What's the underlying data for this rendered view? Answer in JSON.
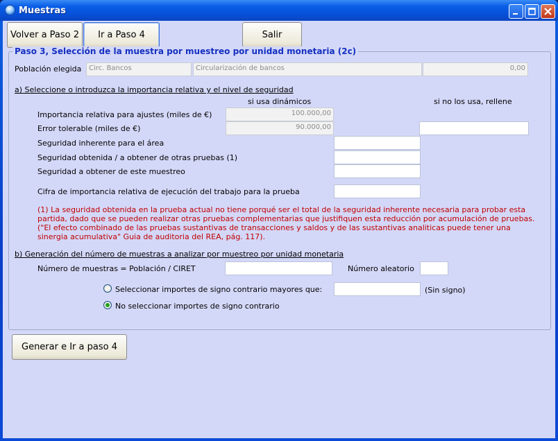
{
  "window": {
    "title": "Muestras"
  },
  "toolbar": {
    "back_label": "Volver a Paso 2",
    "goto_label": "Ir a Paso 4",
    "exit_label": "Salir"
  },
  "group": {
    "title": "Paso 3, Selección de la muestra por muestreo por unidad monetaria (2c)"
  },
  "population": {
    "label": "Población elegida",
    "code": "Circ. Bancos",
    "description": "Circularización de bancos",
    "amount": "0,00"
  },
  "section_a": {
    "title": "a) Seleccione o introduzca la importancia relativa y el nivel de seguridad",
    "col_dynamic": "si usa dinámicos",
    "col_manual": "si no los usa, rellene",
    "materiality_label": "Importancia relativa para ajustes (miles de €)",
    "materiality_value": "100.000,00",
    "tolerable_label": "Error tolerable (miles de €)",
    "tolerable_value": "90.000,00",
    "tolerable_manual": "",
    "inherent_label": "Seguridad inherente para el área",
    "inherent_value": "",
    "obtained_label": "Seguridad obtenida / a obtener de otras pruebas (1)",
    "obtained_value": "",
    "sampling_label": "Seguridad a obtener de este muestreo",
    "sampling_value": "",
    "execution_label": "Cifra de importancia relativa de ejecución del trabajo para la prueba",
    "execution_value": ""
  },
  "note": "(1) La seguridad obtenida en la prueba actual no tiene porqué ser el total de la seguridad inherente necesaria para probar esta partida, dado que se pueden realizar otras pruebas complementarias que justifiquen esta reducción por acumulación de pruebas. (\"El efecto combinado de las pruebas sustantivas de transacciones y saldos y de las sustantivas analiticas puede tener una sinergia acumulativa\" Guia de auditoria del REA, pág. 117).",
  "section_b": {
    "title": "b) Generación del número de muestras a analizar por muestreo por unidad monetaria",
    "samples_label": "Número de muestras = Población / CIRET",
    "samples_value": "",
    "random_label": "Número aleatorio",
    "random_value": "",
    "opt_select_label": "Seleccionar importes de signo contrario mayores que:",
    "opt_select_value": "",
    "opt_select_suffix": "(Sin signo)",
    "opt_none_label": "No seleccionar importes de signo contrario",
    "selected_option": "opt_none"
  },
  "footer": {
    "generate_label": "Generar e Ir a paso 4"
  },
  "colors": {
    "panel": "#d4d8f8",
    "group_title": "#1530c0",
    "note": "#c00000",
    "titlebar": "#0a5ee6"
  },
  "icons": [
    "app-icon",
    "minimize-icon",
    "maximize-icon",
    "close-icon"
  ]
}
